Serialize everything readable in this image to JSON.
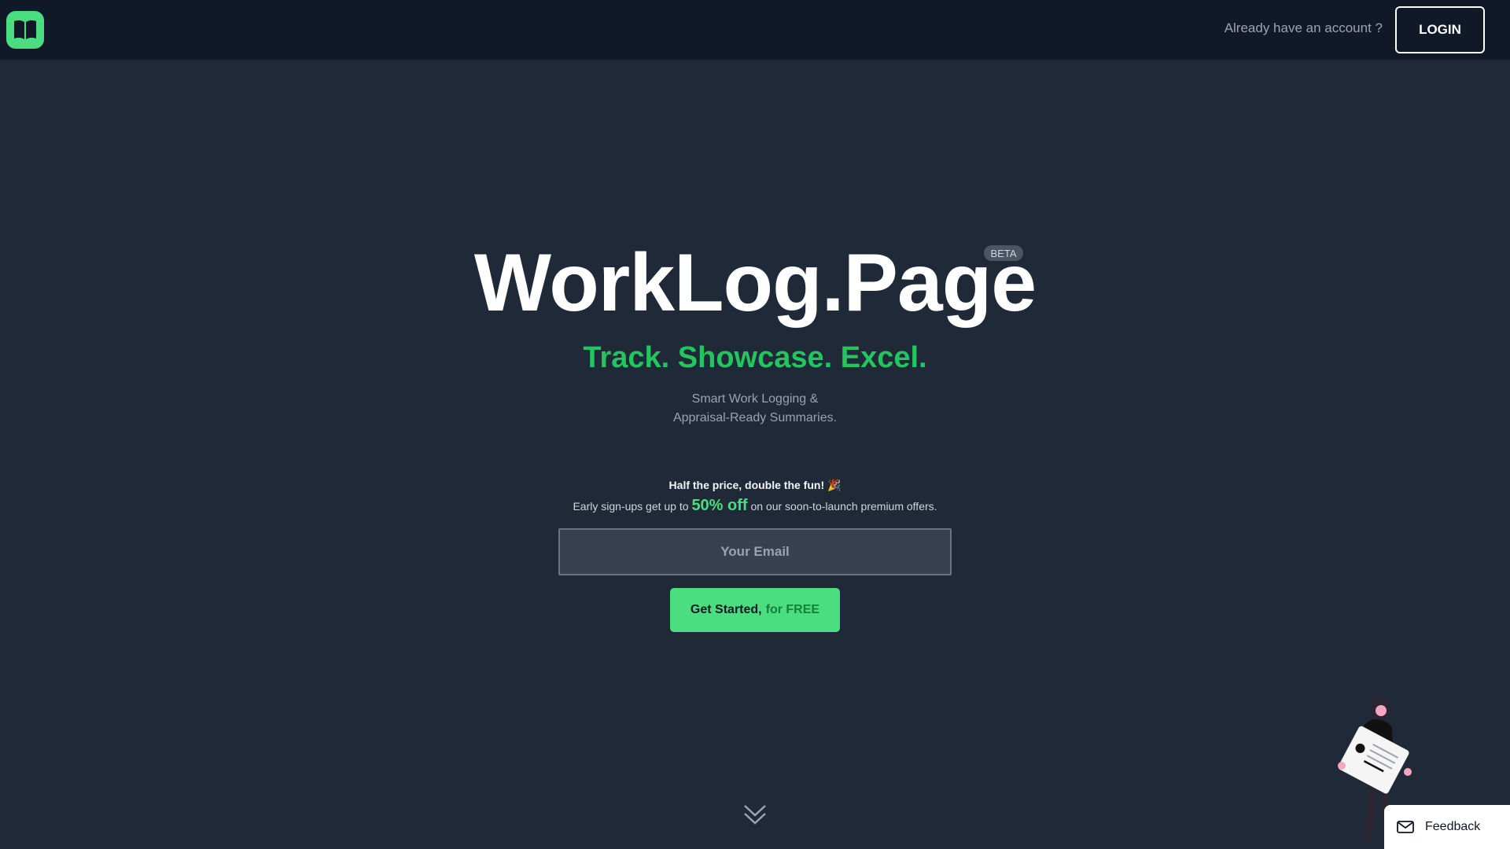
{
  "header": {
    "logo_icon": "open-book-icon",
    "already_text": "Already have an account ?",
    "login_label": "LOGIN"
  },
  "hero": {
    "title": "WorkLog.Page",
    "badge": "BETA",
    "tagline": "Track. Showcase. Excel.",
    "subtext_line1": "Smart Work Logging &",
    "subtext_line2": "Appraisal-Ready Summaries."
  },
  "promo": {
    "headline": "Half the price, double the fun!",
    "headline_emoji": "🎉",
    "line_before": "Early sign-ups get up to",
    "line_highlight": "50% off",
    "line_after": "on our soon-to-launch premium offers."
  },
  "signup": {
    "email_placeholder": "Your Email",
    "email_value": "",
    "cta_main": "Get Started,",
    "cta_accent": "for FREE"
  },
  "scroll_icon": "double-chevron-down-icon",
  "feedback": {
    "icon": "mail-icon",
    "label": "Feedback"
  },
  "colors": {
    "page_bg": "#1f2937",
    "header_bg": "#111827",
    "accent": "#4ade80",
    "tagline": "#22c55e",
    "cta_accent_text": "#15803d",
    "muted_text": "#9ca3af"
  }
}
